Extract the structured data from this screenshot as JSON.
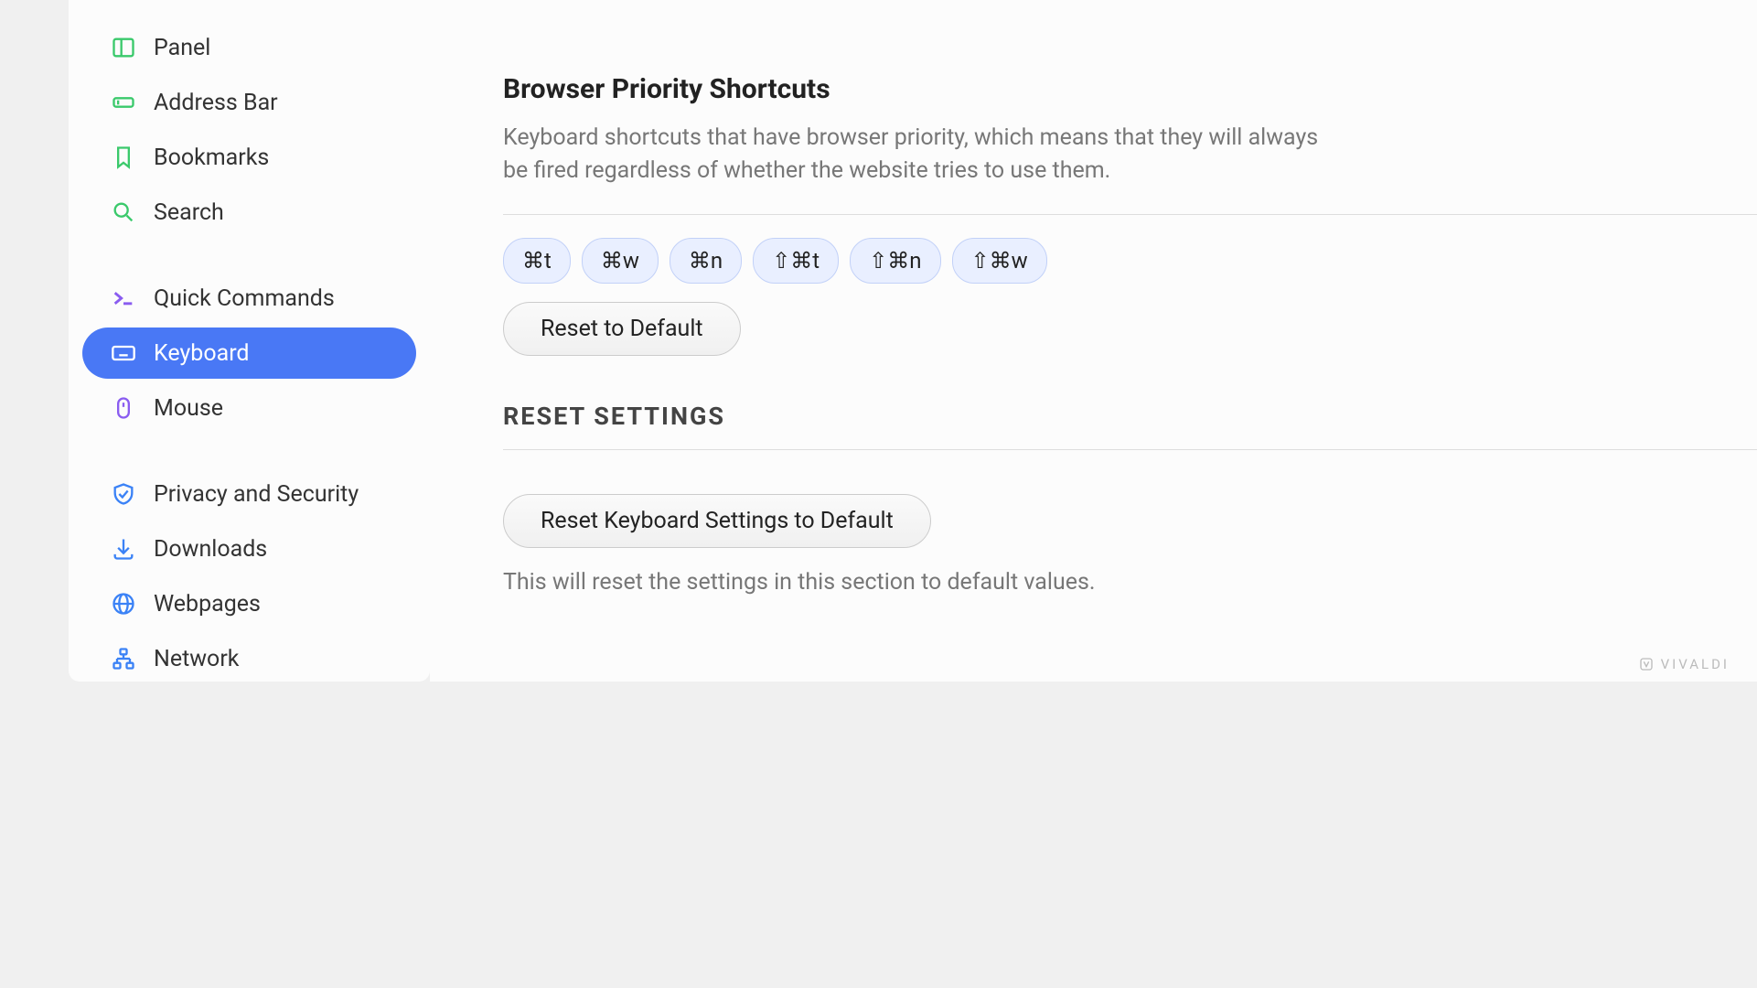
{
  "sidebar": {
    "items": [
      {
        "label": "Panel",
        "icon": "panel"
      },
      {
        "label": "Address Bar",
        "icon": "address"
      },
      {
        "label": "Bookmarks",
        "icon": "bookmark"
      },
      {
        "label": "Search",
        "icon": "search"
      },
      {
        "label": "Quick Commands",
        "icon": "quick"
      },
      {
        "label": "Keyboard",
        "icon": "keyboard",
        "active": true
      },
      {
        "label": "Mouse",
        "icon": "mouse"
      },
      {
        "label": "Privacy and Security",
        "icon": "shield"
      },
      {
        "label": "Downloads",
        "icon": "download"
      },
      {
        "label": "Webpages",
        "icon": "globe"
      },
      {
        "label": "Network",
        "icon": "network"
      }
    ]
  },
  "main": {
    "priority_title": "Browser Priority Shortcuts",
    "priority_desc": "Keyboard shortcuts that have browser priority, which means that they will always be fired regardless of whether the website tries to use them.",
    "shortcuts": [
      "⌘t",
      "⌘w",
      "⌘n",
      "⇧⌘t",
      "⇧⌘n",
      "⇧⌘w"
    ],
    "reset_default_label": "Reset to Default",
    "reset_header": "RESET SETTINGS",
    "reset_keyboard_label": "Reset Keyboard Settings to Default",
    "reset_note": "This will reset the settings in this section to default values."
  },
  "brand": "VIVALDI"
}
